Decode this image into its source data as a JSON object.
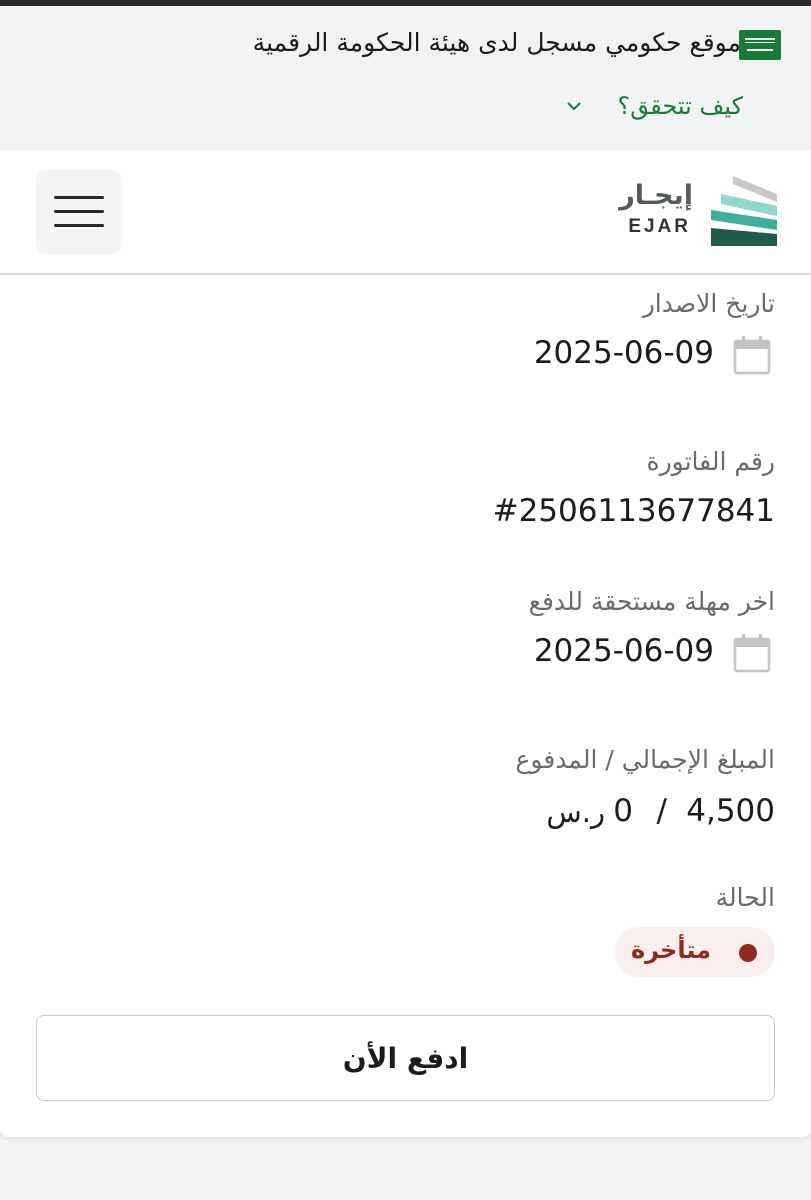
{
  "gov_banner": {
    "text": "موقع حكومي مسجل لدى هيئة الحكومة الرقمية",
    "how_verify": "كيف تتحقق؟"
  },
  "header": {
    "logo_ar": "إيجـار",
    "logo_en": "EJAR"
  },
  "invoice": {
    "issue_date": {
      "label": "تاريخ الاصدار",
      "value": "2025-06-09"
    },
    "invoice_number": {
      "label": "رقم الفاتورة",
      "value": "#2506113677841"
    },
    "due_date": {
      "label": "اخر مهلة مستحقة للدفع",
      "value": "2025-06-09"
    },
    "amount": {
      "label": "المبلغ الإجمالي / المدفوع",
      "total": "4,500",
      "separator": "/",
      "paid": "0",
      "currency": "ر.س"
    },
    "status": {
      "label": "الحالة",
      "value": "متأخرة"
    }
  },
  "actions": {
    "pay_now": "ادفع الأن"
  },
  "colors": {
    "brand_green": "#1b7a3a",
    "status_overdue": "#8f2a23",
    "status_bg": "#fbeeee",
    "logo_teal": "#5bbfae",
    "logo_dark": "#1f5c4e"
  }
}
